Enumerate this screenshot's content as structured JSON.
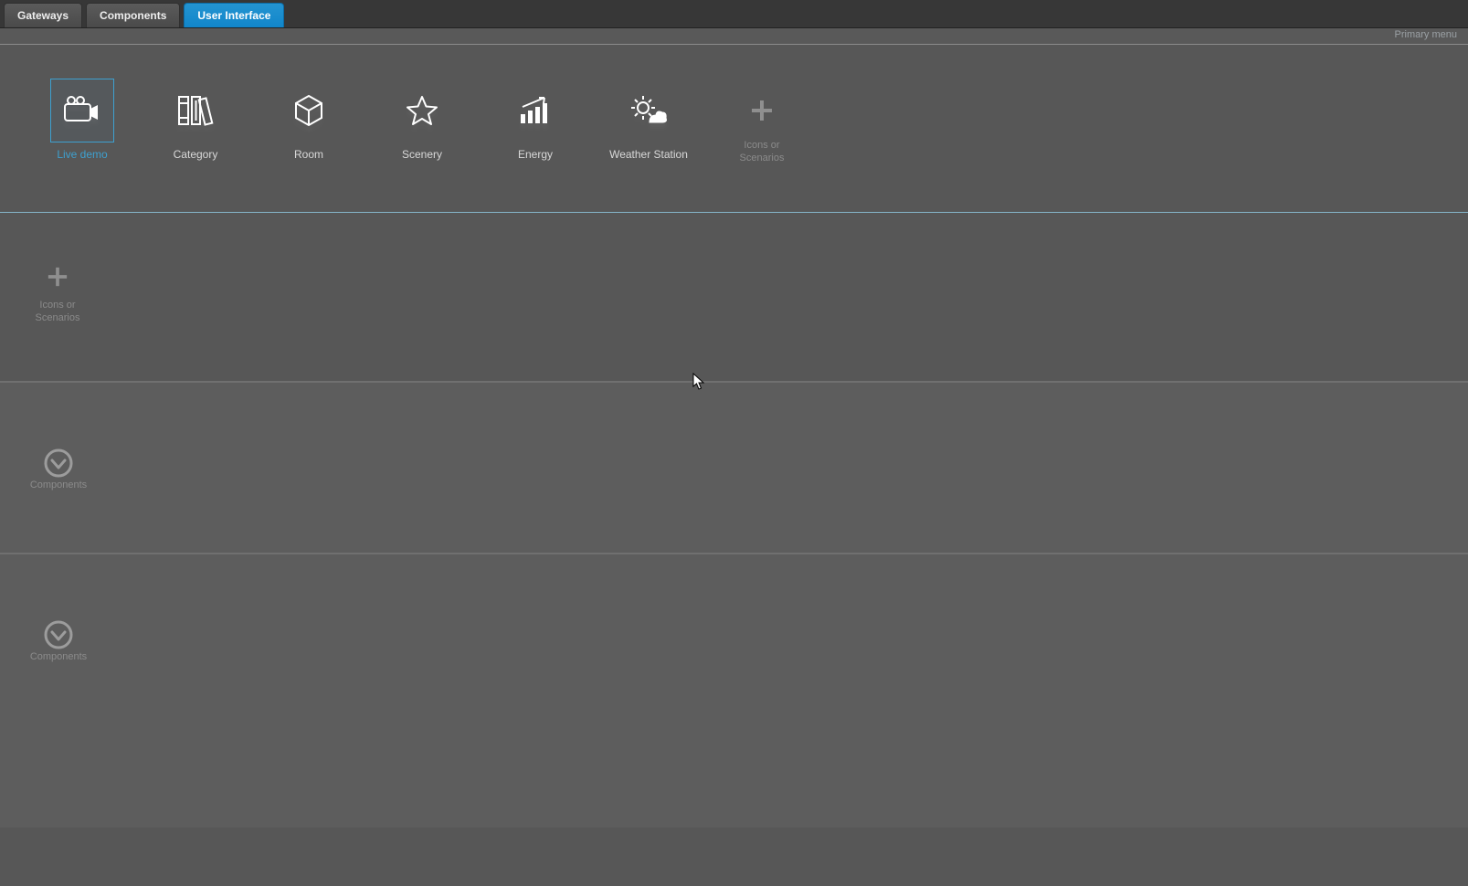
{
  "tabs": {
    "gateways": "Gateways",
    "components": "Components",
    "user_interface": "User Interface"
  },
  "header_link": "Primary menu",
  "menuItems": {
    "live_demo": "Live demo",
    "category": "Category",
    "room": "Room",
    "scenery": "Scenery",
    "energy": "Energy",
    "weather": "Weather Station",
    "add": "Icons or\nScenarios"
  },
  "sub": {
    "add": "Icons or\nScenarios"
  },
  "panels": {
    "components": "Components"
  }
}
